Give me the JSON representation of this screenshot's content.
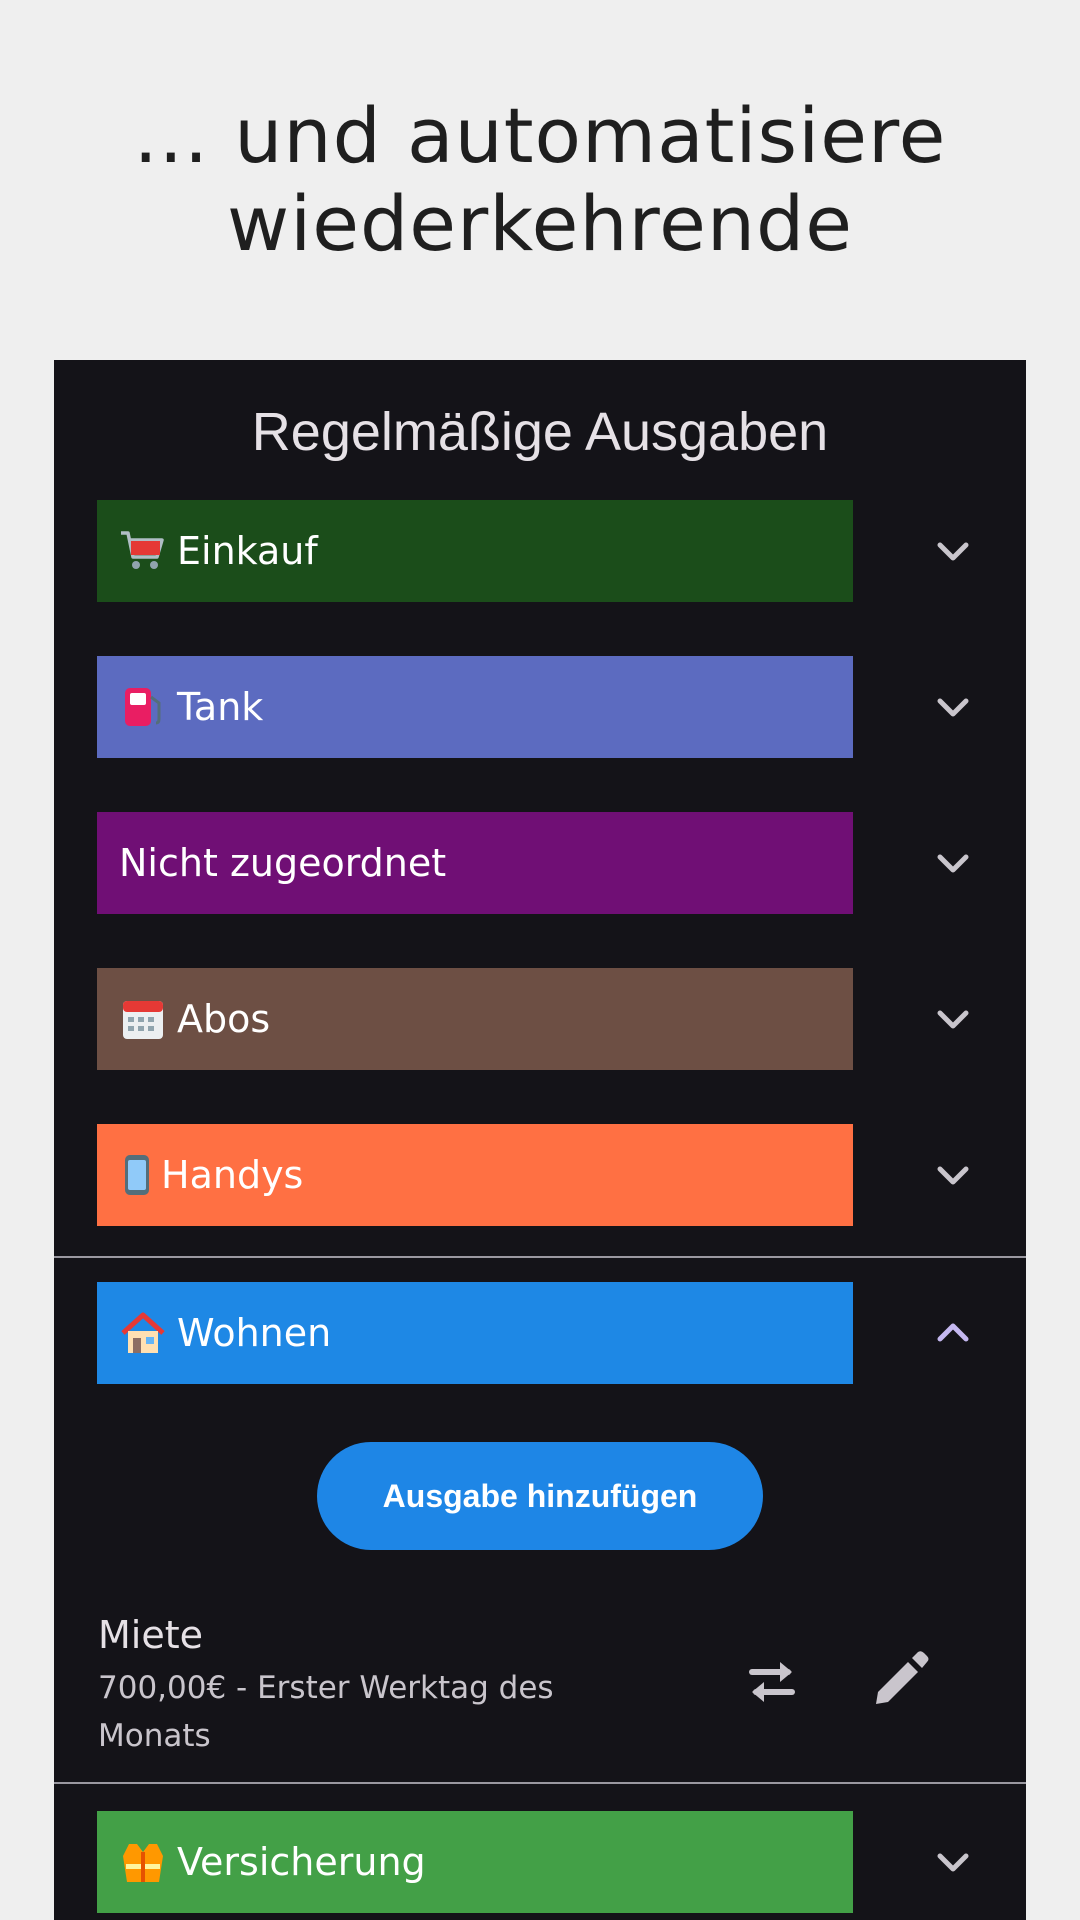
{
  "headline": {
    "line1": "... und automatisiere",
    "line2": "wiederkehrende"
  },
  "screen": {
    "title": "Regelmäßige Ausgaben"
  },
  "categories": [
    {
      "label": "Einkauf",
      "icon": "shopping-cart-icon",
      "color": "#1b4d1a",
      "expanded": false
    },
    {
      "label": "Tank",
      "icon": "fuel-pump-icon",
      "color": "#5c6bc0",
      "expanded": false
    },
    {
      "label": "Nicht zugeordnet",
      "icon": "",
      "color": "#700f75",
      "expanded": false
    },
    {
      "label": "Abos",
      "icon": "calendar-icon",
      "color": "#6d4f44",
      "expanded": false
    },
    {
      "label": "Handys",
      "icon": "mobile-phone-icon",
      "color": "#ff7043",
      "expanded": false
    },
    {
      "label": "Wohnen",
      "icon": "house-icon",
      "color": "#1e88e5",
      "expanded": true
    },
    {
      "label": "Versicherung",
      "icon": "safety-vest-icon",
      "color": "#43a047",
      "expanded": false
    }
  ],
  "wohnen": {
    "add_button_label": "Ausgabe hinzufügen",
    "items": [
      {
        "title": "Miete",
        "subtitle": "700,00€ - Erster Werktag des Monats"
      }
    ]
  },
  "colors": {
    "page_background": "#efefef",
    "screen_background": "#141318",
    "accent_chevron_expanded": "#c5b8f0",
    "chevron": "#c9c5cc"
  }
}
